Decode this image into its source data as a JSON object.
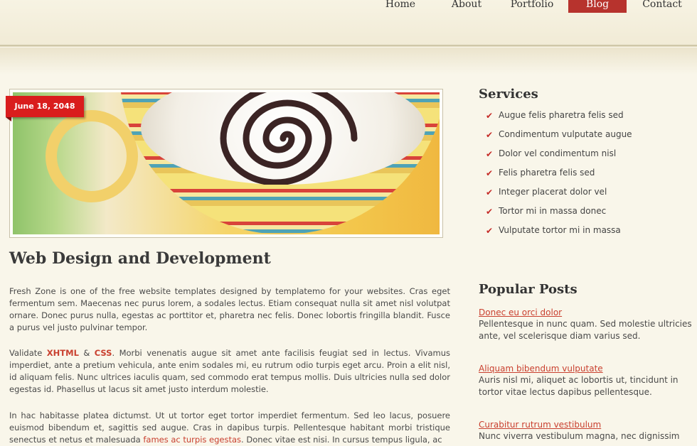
{
  "nav": {
    "items": [
      "Home",
      "About",
      "Portfolio",
      "Blog",
      "Contact"
    ],
    "active": "Blog"
  },
  "post": {
    "date": "June 18, 2048",
    "title": "Web Design and Development",
    "p1": "Fresh Zone is one of the free website templates designed by templatemo for your websites. Cras eget fermentum sem. Maecenas nec purus lorem, a sodales lectus. Etiam consequat nulla sit amet nisl volutpat ornare. Donec purus nulla, egestas ac porttitor et, pharetra nec felis. Donec lobortis fringilla blandit. Fusce a purus vel justo pulvinar tempor.",
    "p2_prefix": "Validate ",
    "p2_xhtml": "XHTML",
    "p2_amp": " & ",
    "p2_css": "CSS",
    "p2_rest": ". Morbi venenatis augue sit amet ante facilisis feugiat sed in lectus. Vivamus imperdiet, ante a pretium vehicula, ante enim sodales mi, eu rutrum odio turpis eget arcu. Proin a elit nisl, id aliquam felis. Nunc ultrices iaculis quam, sed commodo erat tempus mollis. Duis ultricies nulla sed dolor egestas id. Phasellus ut lacus sit amet justo interdum molestie.",
    "p3_prefix": "In hac habitasse platea dictumst. Ut ut tortor eget tortor imperdiet fermentum. Sed leo lacus, posuere euismod bibendum et, sagittis sed augue. Cras in dapibus turpis. Pellentesque habitant morbi tristique senectus et netus et malesuada ",
    "p3_link": "fames ac turpis egestas",
    "p3_suffix": ". Donec vitae est nisi. In cursus tempus ligula, ac"
  },
  "services": {
    "title": "Services",
    "items": [
      "Augue felis pharetra felis sed",
      "Condimentum vulputate augue",
      "Dolor vel condimentum nisl",
      "Felis pharetra felis sed",
      "Integer placerat dolor vel",
      "Tortor mi in massa donec",
      "Vulputate tortor mi in massa"
    ]
  },
  "popular": {
    "title": "Popular Posts",
    "posts": [
      {
        "title": "Donec eu orci dolor",
        "text": "Pellentesque in nunc quam. Sed molestie ultricies ante, vel scelerisque diam varius sed."
      },
      {
        "title": "Aliquam bibendum vulputate",
        "text": "Auris nisl mi, aliquet ac lobortis ut, tincidunt in tortor vitae lectus dapibus pellentesque."
      },
      {
        "title": "Curabitur rutrum vestibulum",
        "text": "Nunc viverra vestibulum magna, nec dignissim"
      }
    ]
  },
  "colors": {
    "accent": "#b7332d",
    "link": "#c9402f",
    "date_tag": "#d91d1d",
    "background": "#f9f6ea"
  }
}
